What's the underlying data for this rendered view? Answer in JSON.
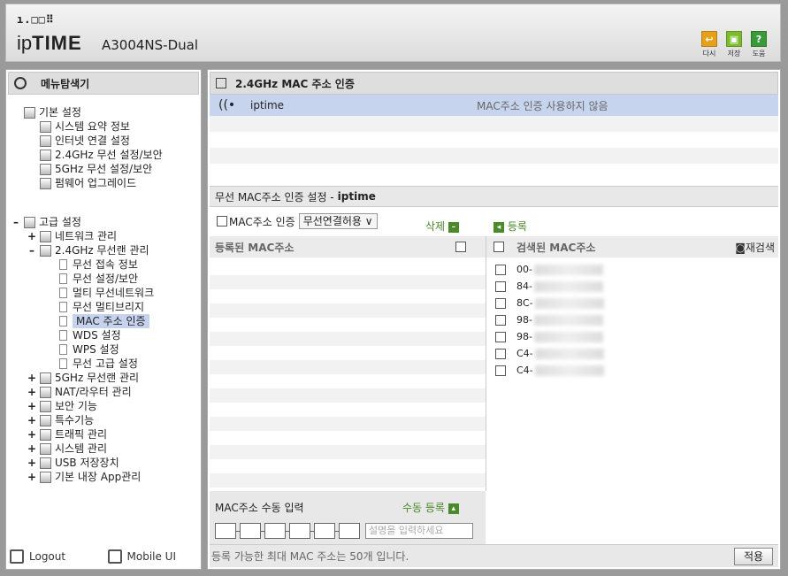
{
  "header": {
    "logo_dots": "ı.□□⠿",
    "brand_prefix": "ip",
    "brand_bold": "TIME",
    "model": "A3004NS-Dual",
    "buttons": [
      {
        "label": "다시",
        "icon": "redo-icon",
        "color": "#e6a11a"
      },
      {
        "label": "저장",
        "icon": "save-icon",
        "color": "#7bbb2c"
      },
      {
        "label": "도움",
        "icon": "help-icon",
        "color": "#3a9a3a"
      }
    ]
  },
  "sidebar": {
    "title": "메뉴탐색기",
    "basic": {
      "label": "기본 설정",
      "items": [
        "시스템 요약 정보",
        "인터넷 연결 설정",
        "2.4GHz 무선 설정/보안",
        "5GHz 무선 설정/보안",
        "펌웨어 업그레이드"
      ]
    },
    "advanced": {
      "label": "고급 설정",
      "network": "네트워크 관리",
      "wlan24": "2.4GHz 무선랜 관리",
      "wlan24_items": [
        "무선 접속 정보",
        "무선 설정/보안",
        "멀티 무선네트워크",
        "무선 멀티브리지",
        "MAC 주소 인증",
        "WDS 설정",
        "WPS 설정",
        "무선 고급 설정"
      ],
      "rest": [
        "5GHz 무선랜 관리",
        "NAT/라우터 관리",
        "보안 기능",
        "특수기능",
        "트래픽 관리",
        "시스템 관리",
        "USB 저장장치",
        "기본 내장 App관리"
      ]
    },
    "logout": "Logout",
    "mobile": "Mobile UI"
  },
  "main": {
    "title": "2.4GHz MAC 주소 인증",
    "ssid": {
      "name": "iptime",
      "status": "MAC주소 인증 사용하지 않음"
    },
    "section_title": "무선 MAC주소 인증 설정 - ",
    "section_ssid": "iptime",
    "mac_auth_label": "MAC주소 인증",
    "policy_value": "무선연결허용",
    "delete_label": "삭제",
    "register_label": "등록",
    "registered_header": "등록된 MAC주소",
    "found_header": "검색된 MAC주소",
    "rescan_label": "재검색",
    "found_macs": [
      "00-",
      "84-",
      "8C-",
      "98-",
      "98-",
      "C4-",
      "C4-"
    ],
    "manual_title": "MAC주소 수동 입력",
    "manual_register": "수동 등록",
    "desc_placeholder": "설명을 입력하세요",
    "footer_note": "등록 가능한 최대 MAC 주소는 50개 입니다.",
    "apply_label": "적용"
  }
}
